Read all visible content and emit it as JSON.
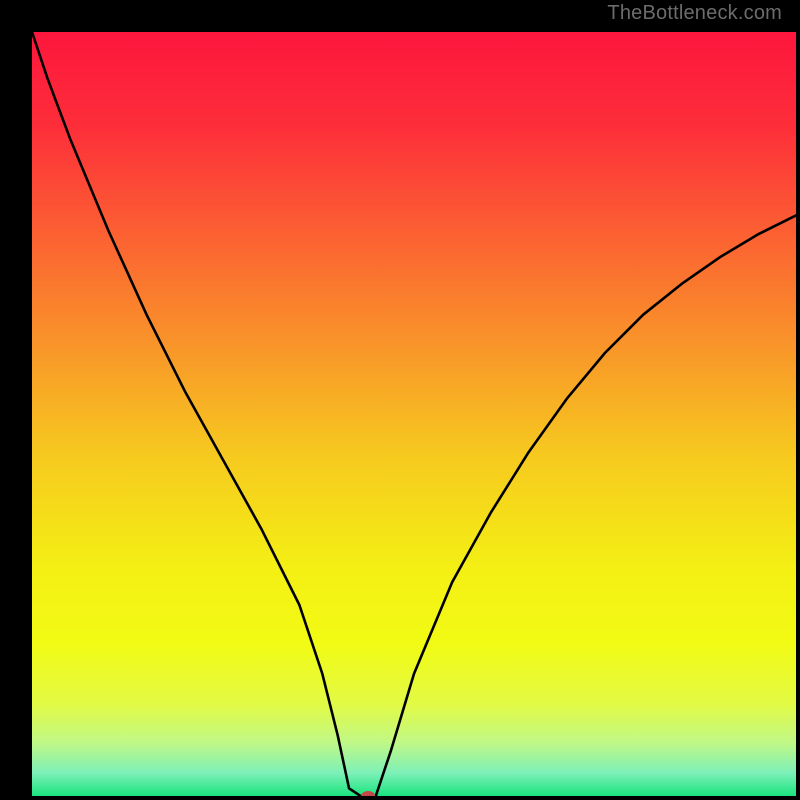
{
  "watermark": {
    "text": "TheBottleneck.com"
  },
  "chart_data": {
    "type": "line",
    "title": "",
    "xlabel": "",
    "ylabel": "",
    "xlim": [
      0,
      100
    ],
    "ylim": [
      0,
      100
    ],
    "grid": false,
    "series": [
      {
        "name": "curve",
        "x": [
          0,
          2,
          5,
          10,
          15,
          20,
          25,
          30,
          35,
          38,
          40,
          41.5,
          43,
          45,
          47,
          50,
          55,
          60,
          65,
          70,
          75,
          80,
          85,
          90,
          95,
          100
        ],
        "y": [
          100,
          94,
          86,
          74,
          63,
          53,
          44,
          35,
          25,
          16,
          8,
          1,
          0,
          0,
          6,
          16,
          28,
          37,
          45,
          52,
          58,
          63,
          67,
          70.5,
          73.5,
          76
        ]
      }
    ],
    "marker": {
      "x": 44,
      "y": 0,
      "color": "#c24b48",
      "rx": 7,
      "ry": 5
    },
    "background_gradient": {
      "stops": [
        {
          "offset": 0.0,
          "color": "#fd163d"
        },
        {
          "offset": 0.12,
          "color": "#fd2d3a"
        },
        {
          "offset": 0.25,
          "color": "#fc5b33"
        },
        {
          "offset": 0.4,
          "color": "#f9912a"
        },
        {
          "offset": 0.55,
          "color": "#f6c81f"
        },
        {
          "offset": 0.7,
          "color": "#f4ef14"
        },
        {
          "offset": 0.8,
          "color": "#f2fb14"
        },
        {
          "offset": 0.88,
          "color": "#e2fa45"
        },
        {
          "offset": 0.93,
          "color": "#c0f886"
        },
        {
          "offset": 0.97,
          "color": "#7df0b8"
        },
        {
          "offset": 1.0,
          "color": "#1ae47d"
        }
      ]
    }
  }
}
